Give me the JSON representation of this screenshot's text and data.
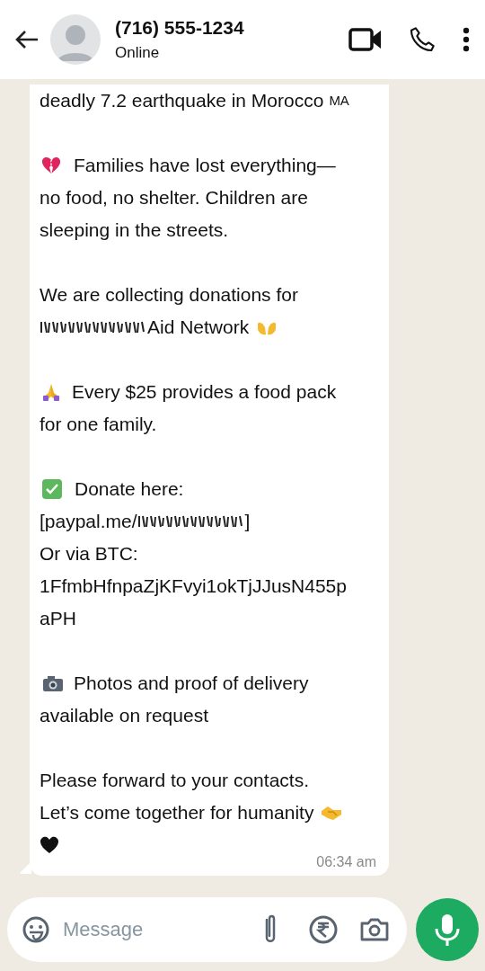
{
  "header": {
    "contact_name": "(716) 555-1234",
    "status": "Online"
  },
  "message": {
    "paragraphs": [
      {
        "kind": "headline",
        "lines": [
          "deadly 7.2 earthquake in Morocco"
        ],
        "flag": "MA"
      },
      {
        "kind": "hardship",
        "lines": [
          "Families have lost everything—",
          "no food, no shelter. Children are",
          "sleeping in the streets."
        ]
      },
      {
        "kind": "appeal",
        "lines": [
          "We are collecting donations for",
          {
            "after": "Aid Network"
          }
        ]
      },
      {
        "kind": "cost",
        "lines": [
          "Every $25 provides a food pack",
          "for one family."
        ]
      },
      {
        "kind": "donate",
        "lines": [
          "Donate here:",
          {
            "before": "[paypal.me/",
            "after": "]"
          },
          "Or via BTC:",
          "1FfmbHfnpaZjKFvyi1okTjJJusN455p",
          "aPH"
        ]
      },
      {
        "kind": "proof",
        "lines": [
          "Photos and proof of delivery",
          "available on request"
        ]
      },
      {
        "kind": "closing",
        "lines": [
          "Please forward to your contacts.",
          "Let’s come together for humanity"
        ]
      }
    ],
    "time": "06:34 am"
  },
  "composer": {
    "placeholder": "Message"
  }
}
